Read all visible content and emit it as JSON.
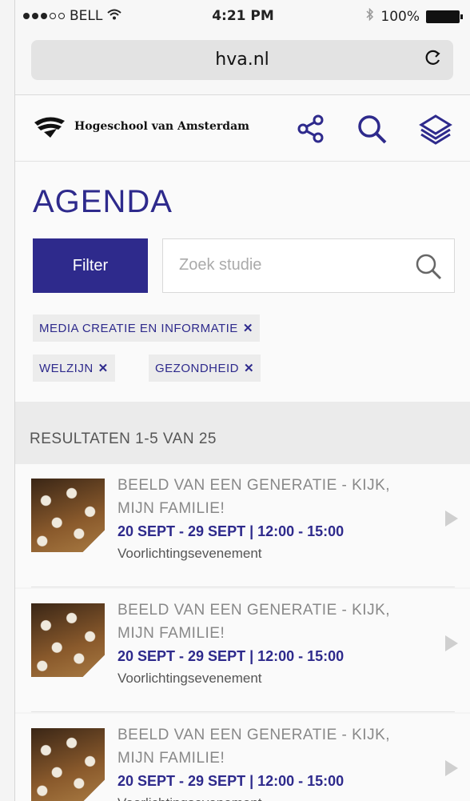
{
  "status_bar": {
    "carrier": "BELL",
    "time": "4:21 PM",
    "battery": "100%"
  },
  "browser": {
    "url": "hva.nl"
  },
  "header": {
    "logo_text": "Hogeschool van Amsterdam"
  },
  "page": {
    "title": "AGENDA",
    "filter_label": "Filter",
    "search_placeholder": "Zoek studie",
    "tags": [
      {
        "label": "MEDIA CREATIE EN INFORMATIE",
        "remove": "✕"
      },
      {
        "label": "WELZIJN",
        "remove": "✕"
      },
      {
        "label": "GEZONDHEID",
        "remove": "✕"
      }
    ]
  },
  "results": {
    "summary": "RESULTATEN 1-5 VAN 25",
    "items": [
      {
        "title": "BEELD VAN EEN GENERATIE - KIJK, MIJN FAMILIE!",
        "date": "20 SEPT - 29 SEPT | 12:00 - 15:00",
        "type": "Voorlichtingsevenement"
      },
      {
        "title": "BEELD VAN EEN GENERATIE - KIJK, MIJN FAMILIE!",
        "date": "20 SEPT - 29 SEPT | 12:00 - 15:00",
        "type": "Voorlichtingsevenement"
      },
      {
        "title": "BEELD VAN EEN GENERATIE - KIJK, MIJN FAMILIE!",
        "date": "20 SEPT - 29 SEPT | 12:00 - 15:00",
        "type": "Voorlichtingsevenement"
      }
    ]
  },
  "colors": {
    "brand": "#2e2a8c",
    "tag_bg": "#ececec"
  },
  "icons": [
    "share-icon",
    "search-icon",
    "layers-icon",
    "reload-icon",
    "wifi-icon",
    "bluetooth-icon",
    "battery-icon",
    "play-arrow-icon"
  ]
}
